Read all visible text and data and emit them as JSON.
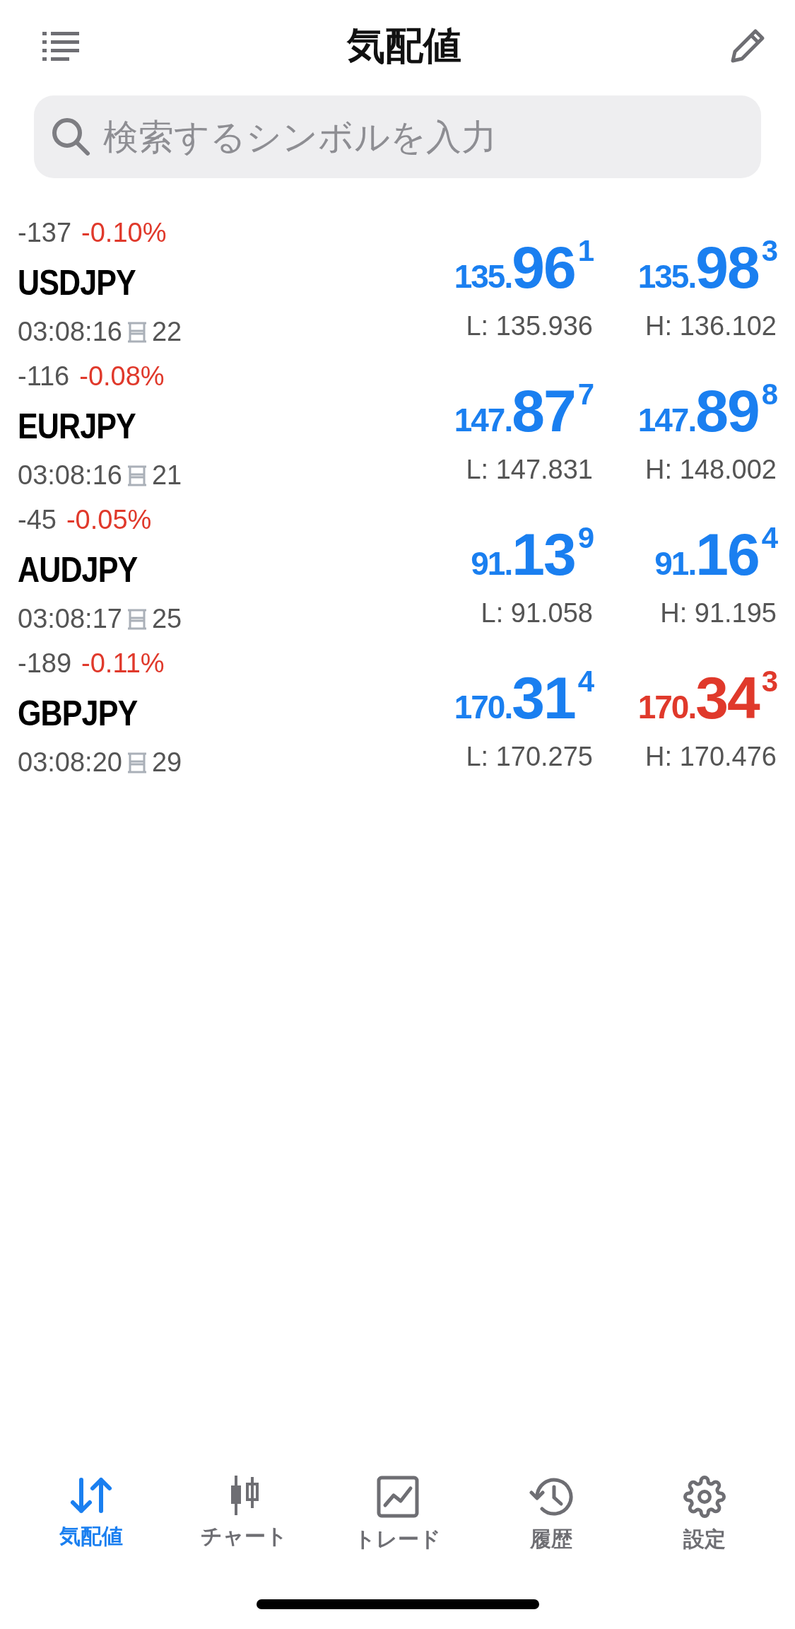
{
  "header": {
    "title": "気配値"
  },
  "search": {
    "placeholder": "検索するシンボルを入力"
  },
  "quotes": [
    {
      "change_points": "-137",
      "change_percent": "-0.10%",
      "symbol": "USDJPY",
      "time": "03:08:16",
      "spread": "22",
      "bid": {
        "prefix": "135.",
        "main": "96",
        "pip": "1",
        "color": "#1a7ff0"
      },
      "ask": {
        "prefix": "135.",
        "main": "98",
        "pip": "3",
        "color": "#1a7ff0"
      },
      "low": "L: 135.936",
      "high": "H: 136.102"
    },
    {
      "change_points": "-116",
      "change_percent": "-0.08%",
      "symbol": "EURJPY",
      "time": "03:08:16",
      "spread": "21",
      "bid": {
        "prefix": "147.",
        "main": "87",
        "pip": "7",
        "color": "#1a7ff0"
      },
      "ask": {
        "prefix": "147.",
        "main": "89",
        "pip": "8",
        "color": "#1a7ff0"
      },
      "low": "L: 147.831",
      "high": "H: 148.002"
    },
    {
      "change_points": "-45",
      "change_percent": "-0.05%",
      "symbol": "AUDJPY",
      "time": "03:08:17",
      "spread": "25",
      "bid": {
        "prefix": "91.",
        "main": "13",
        "pip": "9",
        "color": "#1a7ff0"
      },
      "ask": {
        "prefix": "91.",
        "main": "16",
        "pip": "4",
        "color": "#1a7ff0"
      },
      "low": "L: 91.058",
      "high": "H: 91.195"
    },
    {
      "change_points": "-189",
      "change_percent": "-0.11%",
      "symbol": "GBPJPY",
      "time": "03:08:20",
      "spread": "29",
      "bid": {
        "prefix": "170.",
        "main": "31",
        "pip": "4",
        "color": "#1a7ff0"
      },
      "ask": {
        "prefix": "170.",
        "main": "34",
        "pip": "3",
        "color": "#e0392b"
      },
      "low": "L: 170.275",
      "high": "H: 170.476"
    }
  ],
  "tab_bar": [
    {
      "kind": "quotes",
      "label": "気配値",
      "selected": true
    },
    {
      "kind": "chart",
      "label": "チャート",
      "selected": false
    },
    {
      "kind": "trade",
      "label": "トレード",
      "selected": false
    },
    {
      "kind": "history",
      "label": "履歴",
      "selected": false
    },
    {
      "kind": "settings",
      "label": "設定",
      "selected": false
    }
  ]
}
